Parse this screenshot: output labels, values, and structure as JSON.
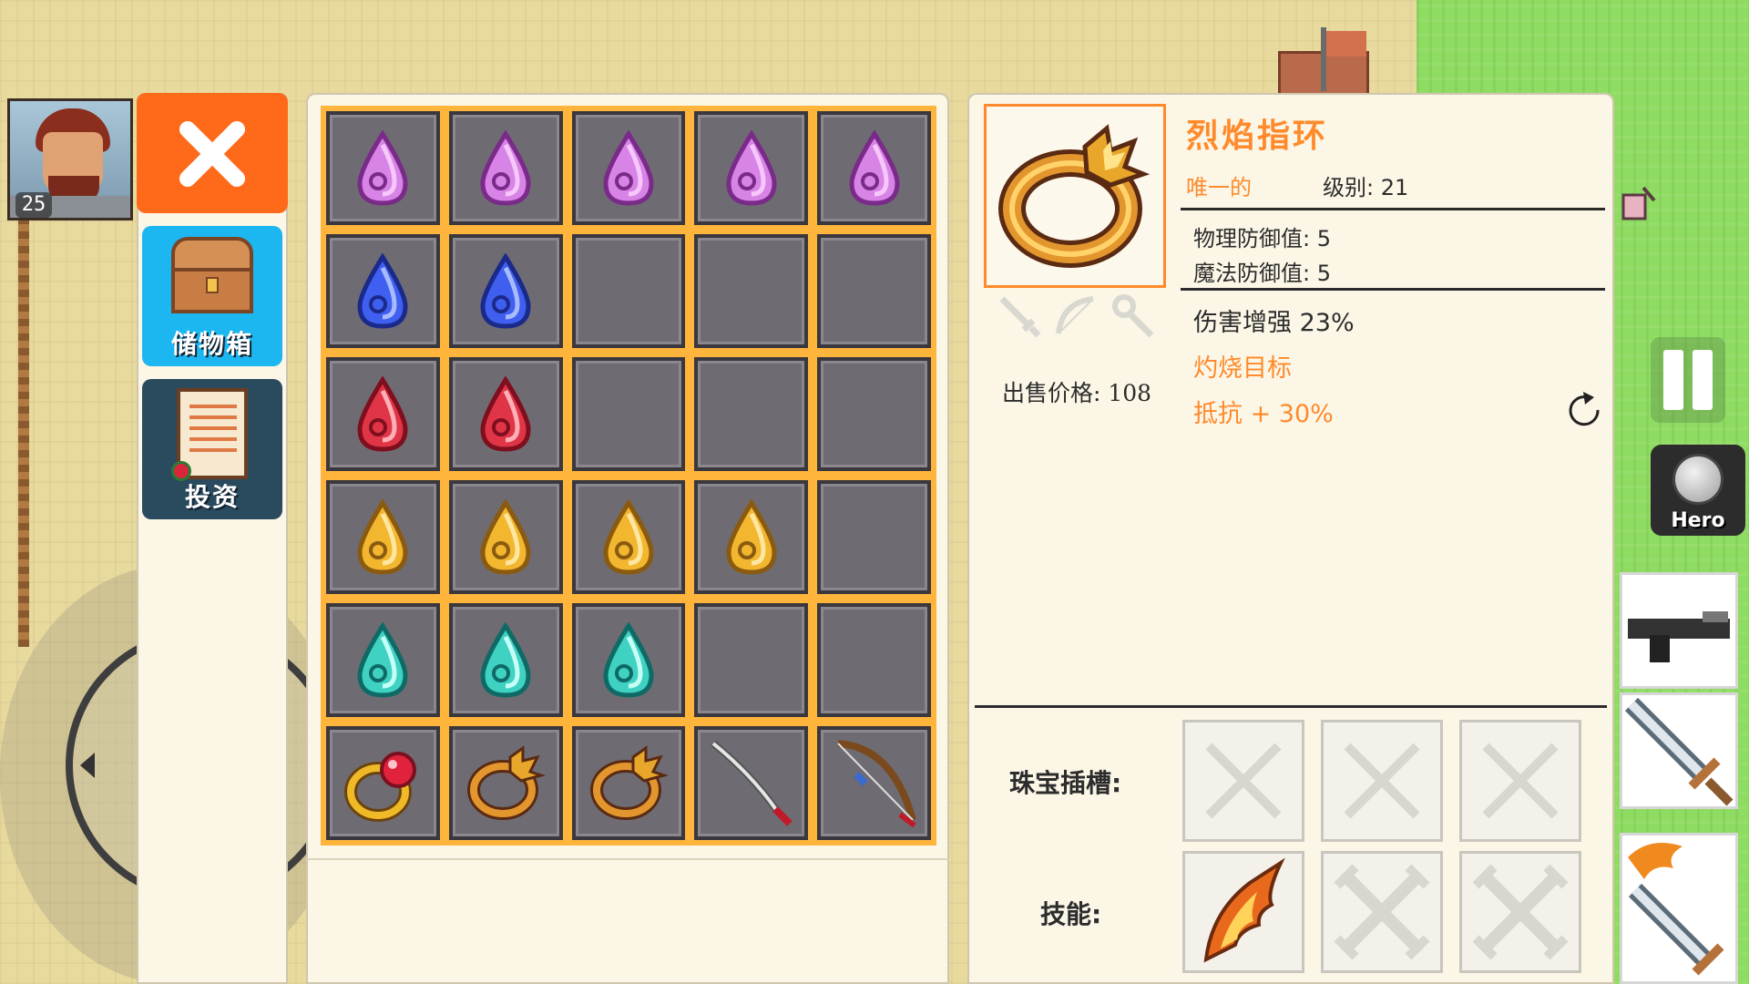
{
  "player": {
    "level": "25"
  },
  "sidebar": {
    "tabs": [
      {
        "label": "储物箱",
        "icon": "chest-icon",
        "active": true
      },
      {
        "label": "投资",
        "icon": "scroll-icon",
        "active": false
      }
    ]
  },
  "inventory": {
    "rows": [
      [
        "purple-gem",
        "purple-gem",
        "purple-gem",
        "purple-gem",
        "purple-gem"
      ],
      [
        "blue-gem",
        "blue-gem",
        "",
        "",
        ""
      ],
      [
        "red-gem",
        "red-gem",
        "",
        "",
        ""
      ],
      [
        "yellow-gem",
        "yellow-gem",
        "yellow-gem",
        "yellow-gem",
        ""
      ],
      [
        "teal-gem",
        "teal-gem",
        "teal-gem",
        "",
        ""
      ],
      [
        "ruby-ring",
        "flame-ring",
        "flame-ring",
        "katana",
        "bow"
      ]
    ]
  },
  "detail": {
    "name": "烈焰指环",
    "rarity": "唯一的",
    "level": "级别: 21",
    "stats": [
      "物理防御值: 5",
      "魔法防御值: 5"
    ],
    "bonuses": [
      {
        "text": "伤害增强 23%",
        "color": "dark"
      },
      {
        "text": "灼烧目标",
        "color": "orange"
      },
      {
        "text": "抵抗 + 30%",
        "color": "orange"
      }
    ],
    "price": "出售价格: 108",
    "gem_slots_label": "珠宝插槽:",
    "skills_label": "技能:",
    "gem_slots": [
      "empty",
      "empty",
      "empty"
    ],
    "skills": [
      "flame-slash",
      "locked",
      "locked"
    ]
  },
  "hud": {
    "hero_label": "Hero"
  },
  "colors": {
    "accent": "#ff8a2b",
    "close": "#ff6a1a",
    "storage_tab": "#1cb6f0",
    "grid": "#ffb53c"
  }
}
